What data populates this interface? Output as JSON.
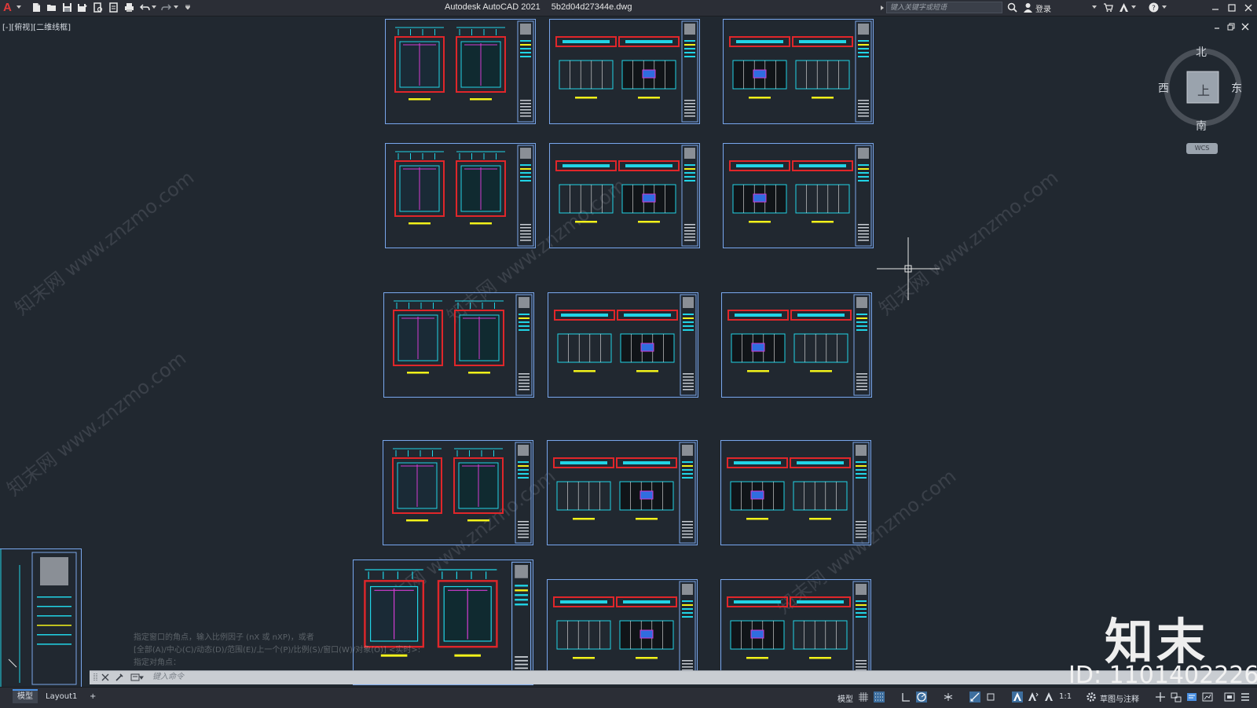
{
  "titlebar": {
    "app_name": "Autodesk AutoCAD 2021",
    "file_name": "5b2d04d27344e.dwg",
    "search_placeholder": "键入关键字或短语",
    "login_label": "登录",
    "quick_access_icons": [
      "new-icon",
      "open-icon",
      "save-icon",
      "save-as-icon",
      "plot-preview-icon",
      "publish-icon",
      "print-icon",
      "undo-icon",
      "redo-icon",
      "customize-icon"
    ]
  },
  "viewport": {
    "view_label": "[-][俯视][二维线框]",
    "viewcube": {
      "north": "北",
      "south": "南",
      "east": "东",
      "west": "西",
      "face": "上",
      "wcs": "WCS"
    },
    "sheet_count": 15,
    "watermark_text": "知末网 www.znzmo.com"
  },
  "command": {
    "history": [
      "指定窗口的角点，输入比例因子 (nX 或 nXP)，或者",
      "[全部(A)/中心(C)/动态(D)/范围(E)/上一个(P)/比例(S)/窗口(W)/对象(O)] <实时>:",
      "指定对角点："
    ],
    "input_placeholder": "键入命令"
  },
  "statusbar": {
    "tabs": [
      "模型",
      "Layout1"
    ],
    "add_tab": "+",
    "model_label": "模型",
    "scale": "1:1",
    "workspace": "草图与注释"
  },
  "brand": {
    "name": "知末",
    "id_text": "ID: 1101402226"
  },
  "colors": {
    "background": "#212830",
    "sheet_border": "#7aa6e8",
    "cyan": "#21d4e6",
    "red": "#e0262a",
    "yellow": "#f2f21a",
    "magenta": "#d23cd2",
    "white": "#e8e8e8",
    "blue": "#2f6de0"
  }
}
